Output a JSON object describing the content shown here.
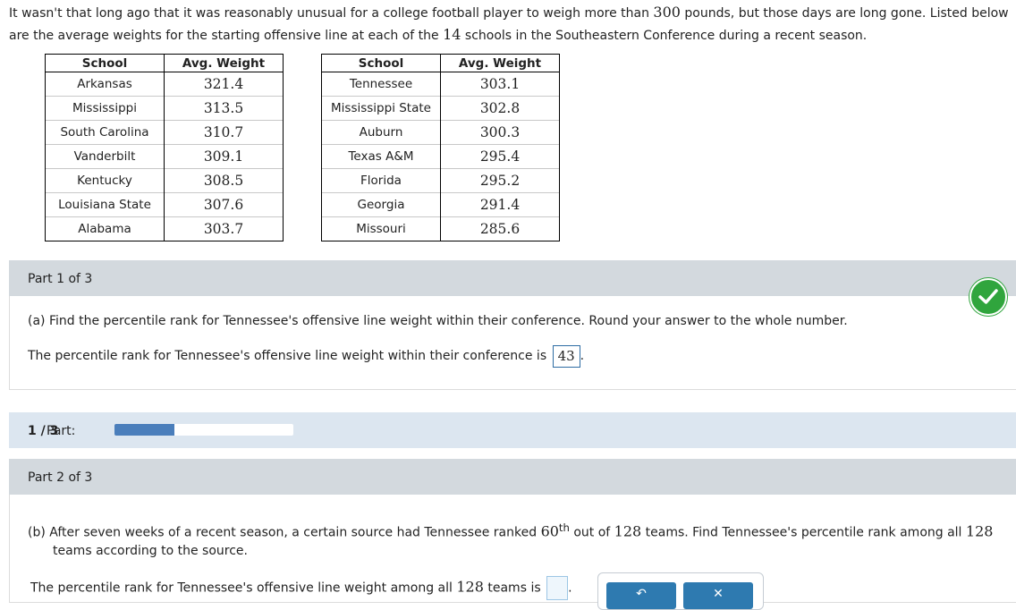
{
  "intro": {
    "text_before": "It wasn't that long ago that it was reasonably unusual for a college football player to weigh more than ",
    "num1": "300",
    "text_middle": " pounds, but those days are long gone. Listed below are the average weights for the starting offensive line at each of the ",
    "num2": "14",
    "text_after": " schools in the Southeastern Conference during a recent season."
  },
  "table": {
    "headers": [
      "School",
      "Avg. Weight"
    ],
    "left": [
      {
        "school": "Arkansas",
        "weight": "321.4"
      },
      {
        "school": "Mississippi",
        "weight": "313.5"
      },
      {
        "school": "South Carolina",
        "weight": "310.7"
      },
      {
        "school": "Vanderbilt",
        "weight": "309.1"
      },
      {
        "school": "Kentucky",
        "weight": "308.5"
      },
      {
        "school": "Louisiana State",
        "weight": "307.6"
      },
      {
        "school": "Alabama",
        "weight": "303.7"
      }
    ],
    "right": [
      {
        "school": "Tennessee",
        "weight": "303.1"
      },
      {
        "school": "Mississippi State",
        "weight": "302.8"
      },
      {
        "school": "Auburn",
        "weight": "300.3"
      },
      {
        "school": "Texas A&M",
        "weight": "295.4"
      },
      {
        "school": "Florida",
        "weight": "295.2"
      },
      {
        "school": "Georgia",
        "weight": "291.4"
      },
      {
        "school": "Missouri",
        "weight": "285.6"
      }
    ]
  },
  "part1": {
    "header": "Part 1 of 3",
    "question": "(a) Find the percentile rank for Tennessee's offensive line weight within their conference. Round your answer to the whole number.",
    "answer_prefix": "The percentile rank for Tennessee's offensive line weight within their conference is",
    "answer_value": "43",
    "answer_suffix": "."
  },
  "progress": {
    "label": "Part:",
    "value": "1 / 3",
    "fraction": 0.333
  },
  "part2": {
    "header": "Part 2 of 3",
    "q_before": "(b) After seven weeks of a recent season, a certain source had Tennessee ranked ",
    "q_rank": "60",
    "q_sup": "th",
    "q_middle": " out of ",
    "q_num": "128",
    "q_after": " teams. Find Tennessee's percentile rank among all ",
    "q_num2": "128",
    "q_line2": "teams according to the source.",
    "answer_prefix": "The percentile rank for Tennessee's offensive line weight among all",
    "answer_num": "128",
    "answer_mid": "teams is",
    "answer_suffix": "."
  },
  "icons": {
    "check": "check-circle-icon",
    "undo": "undo-icon",
    "clear": "clear-icon"
  },
  "colors": {
    "panel_header": "#d3d9de",
    "progress_panel": "#dce6f0",
    "progress_fill": "#4a7ebb",
    "check": "#30a53d",
    "tool_button": "#2e7ab0"
  }
}
